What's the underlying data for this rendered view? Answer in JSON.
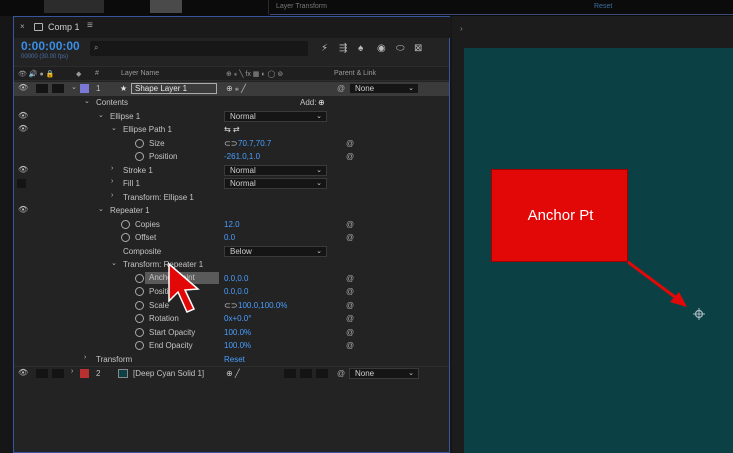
{
  "topbar": {
    "layer_transform_label": "Layer Transform",
    "reset_label": "Reset"
  },
  "panel": {
    "tab_title": "Comp 1",
    "close_glyph": "×",
    "menu_glyph": "≡",
    "timecode": "0:00:00:00",
    "timecode_sub": "00000 (30.00 fps)",
    "search_icon": "⌕",
    "toolbar_icons": [
      "render-icon",
      "graph-icon",
      "shy-icon",
      "motion-blur-icon",
      "draft-icon",
      "graph-editor-icon"
    ]
  },
  "columns": {
    "hash": "#",
    "layer_name": "Layer Name",
    "parent_link": "Parent & Link"
  },
  "layers": {
    "layer1": {
      "num": "1",
      "name": "Shape Layer 1",
      "parent": "None"
    },
    "layer2": {
      "num": "2",
      "name": "[Deep Cyan Solid 1]",
      "parent": "None"
    }
  },
  "props": {
    "contents": "Contents",
    "add": "Add:",
    "ellipse1": "Ellipse 1",
    "ellipse1_mode": "Normal",
    "ellipse_path1": "Ellipse Path 1",
    "size": "Size",
    "size_val": "70.7,70.7",
    "position": "Position",
    "position_val": "-261.0,1.0",
    "stroke1": "Stroke 1",
    "stroke1_mode": "Normal",
    "fill1": "Fill 1",
    "fill1_mode": "Normal",
    "transform_ellipse1": "Transform: Ellipse 1",
    "repeater1": "Repeater 1",
    "copies": "Copies",
    "copies_val": "12.0",
    "offset": "Offset",
    "offset_val": "0.0",
    "composite": "Composite",
    "composite_val": "Below",
    "transform_repeater1": "Transform: Repeater 1",
    "anchor_point": "Anchor Point",
    "anchor_point_val": "0.0,0.0",
    "posit": "Position",
    "posit_val": "0.0,0.0",
    "scale": "Scale",
    "scale_val": "100.0,100.0%",
    "rotation": "Rotation",
    "rotation_val": "0x+0.0°",
    "start_opacity": "Start Opacity",
    "start_opacity_val": "100.0%",
    "end_opacity": "End Opacity",
    "end_opacity_val": "100.0%",
    "transform": "Transform",
    "transform_val": "Reset"
  },
  "callout": {
    "text": "Anchor Pt",
    "color": "#e30808"
  },
  "colors": {
    "accent": "#4a9eff",
    "viewer_bg": "#0b4145",
    "label_shape": "#7a7ad6",
    "label_solid": "#b83030"
  }
}
